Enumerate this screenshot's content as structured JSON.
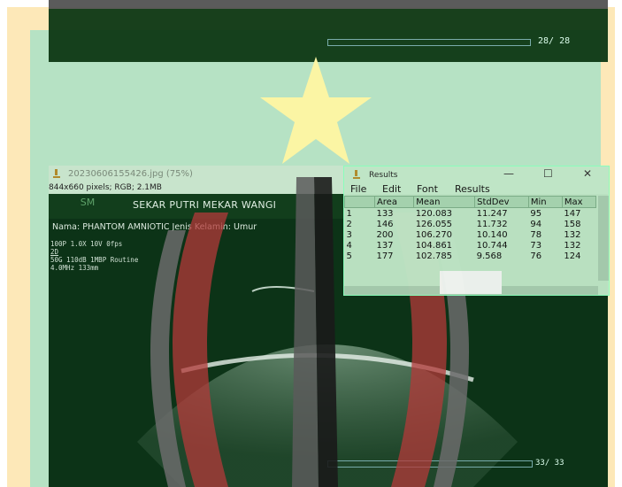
{
  "top_viewer": {
    "counter": "28/ 28"
  },
  "image_window": {
    "title": "20230606155426.jpg (75%)",
    "subtitle": "844x660 pixels; RGB; 2.1MB",
    "clinic_name": "SEKAR PUTRI MEKAR WANGI",
    "logo_text": "SM",
    "patient_line": "Nama:  PHANTOM AMNIOTIC   Jenis Kelamin:      Umur",
    "params": [
      "100P 1.0X 10V   0fps",
      "2D",
      "50G 110dB 1MBP Routine",
      "4.0MHz 133mm"
    ],
    "counter": "33/ 33"
  },
  "results_window": {
    "title": "Results",
    "buttons": {
      "minimize": "—",
      "maximize": "☐",
      "close": "✕"
    },
    "menu": [
      "File",
      "Edit",
      "Font",
      "Results"
    ],
    "columns": [
      "",
      "Area",
      "Mean",
      "StdDev",
      "Min",
      "Max"
    ],
    "rows": [
      [
        "1",
        "133",
        "120.083",
        "11.247",
        "95",
        "147"
      ],
      [
        "2",
        "146",
        "126.055",
        "11.732",
        "94",
        "158"
      ],
      [
        "3",
        "200",
        "106.270",
        "10.140",
        "78",
        "132"
      ],
      [
        "4",
        "137",
        "104.861",
        "10.744",
        "73",
        "132"
      ],
      [
        "5",
        "177",
        "102.785",
        "9.568",
        "76",
        "124"
      ]
    ]
  },
  "colors": {
    "frame": "#fde8b8",
    "overlay": "#b6e2c4",
    "ultrasound_bg": "#0c3317",
    "star": "#fbf5a4",
    "band_red": "#b33a3a"
  }
}
